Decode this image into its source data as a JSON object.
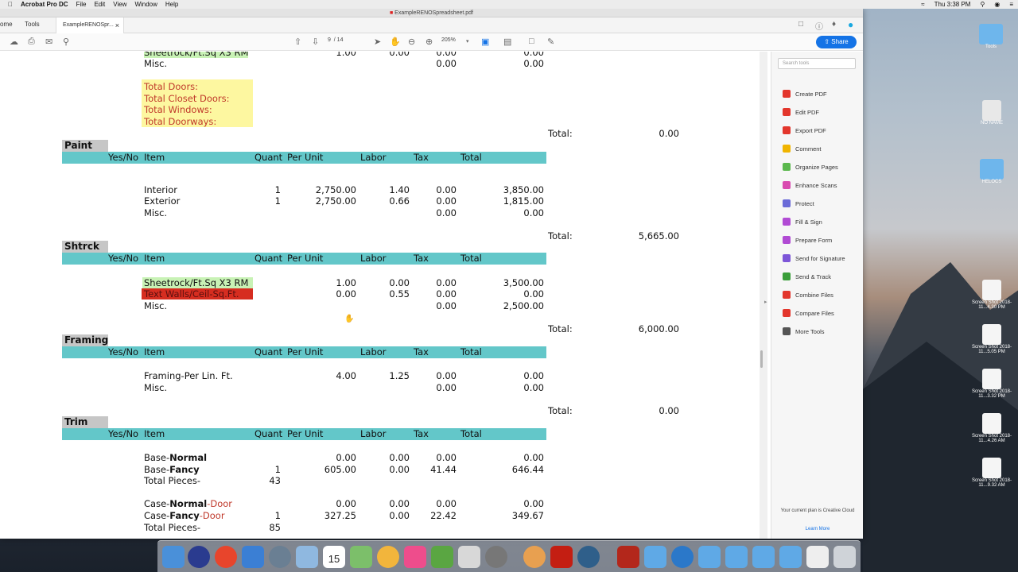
{
  "menubar": {
    "app": "Acrobat Pro DC",
    "items": [
      "File",
      "Edit",
      "View",
      "Window",
      "Help"
    ],
    "time": "Thu 3:38 PM"
  },
  "window": {
    "title": "ExampleRENOSpreadsheet.pdf"
  },
  "tabs": {
    "home": "ome",
    "tools": "Tools",
    "doc": "ExampleRENOSpr...",
    "close": "×"
  },
  "toolbar": {
    "page_current": "9",
    "page_total": "/ 14",
    "zoom": "205%",
    "share_label": "Share"
  },
  "right_panel": {
    "search_placeholder": "Search tools",
    "tools": [
      {
        "label": "Create PDF",
        "color": "#e3362c"
      },
      {
        "label": "Edit PDF",
        "color": "#e3362c"
      },
      {
        "label": "Export PDF",
        "color": "#e3362c"
      },
      {
        "label": "Comment",
        "color": "#f0b400"
      },
      {
        "label": "Organize Pages",
        "color": "#5bb84d"
      },
      {
        "label": "Enhance Scans",
        "color": "#d94bb0"
      },
      {
        "label": "Protect",
        "color": "#6b6bd8"
      },
      {
        "label": "Fill & Sign",
        "color": "#b14bd4"
      },
      {
        "label": "Prepare Form",
        "color": "#b14bd4"
      },
      {
        "label": "Send for Signature",
        "color": "#7d56d8"
      },
      {
        "label": "Send & Track",
        "color": "#3a9e3a"
      },
      {
        "label": "Combine Files",
        "color": "#e3362c"
      },
      {
        "label": "Compare Files",
        "color": "#e3362c"
      },
      {
        "label": "More Tools",
        "color": "#555555"
      }
    ],
    "plan_text": "Your current plan is Creative Cloud",
    "learn_more": "Learn More"
  },
  "col_headers": {
    "yesno": "Yes/No",
    "item": "Item",
    "quant": "Quant",
    "perunit": "Per Unit",
    "labor": "Labor",
    "tax": "Tax",
    "total": "Total"
  },
  "top": {
    "r1": {
      "item": "Sheetrock/Ft.Sq X3 RM",
      "per": "1.00",
      "labor": "0.00",
      "tax": "0.00",
      "total": "0.00"
    },
    "r2": {
      "item": "Misc.",
      "tax": "0.00",
      "total": "0.00"
    },
    "door_totals": [
      "Total Doors:",
      "Total Closet Doors:",
      "Total Windows:",
      "Total Doorways:"
    ],
    "total_label": "Total:",
    "total_value": "0.00"
  },
  "paint": {
    "title": "Paint",
    "r1": {
      "item": "Interior",
      "q": "1",
      "per": "2,750.00",
      "labor": "1.40",
      "tax": "0.00",
      "total": "3,850.00"
    },
    "r2": {
      "item": "Exterior",
      "q": "1",
      "per": "2,750.00",
      "labor": "0.66",
      "tax": "0.00",
      "total": "1,815.00"
    },
    "r3": {
      "item": "Misc.",
      "tax": "0.00",
      "total": "0.00"
    },
    "total_label": "Total:",
    "total_value": "5,665.00"
  },
  "shtrck": {
    "title": "Shtrck",
    "r1": {
      "item": "Sheetrock/Ft.Sq X3 RM",
      "per": "1.00",
      "labor": "0.00",
      "tax": "0.00",
      "total": "3,500.00"
    },
    "r2": {
      "item": "Text Walls/Ceil-Sq.Ft.",
      "per": "0.00",
      "labor": "0.55",
      "tax": "0.00",
      "total": "0.00"
    },
    "r3": {
      "item": "Misc.",
      "tax": "0.00",
      "total": "2,500.00"
    },
    "total_label": "Total:",
    "total_value": "6,000.00"
  },
  "framing": {
    "title": "Framing",
    "r1": {
      "item": "Framing-Per Lin. Ft.",
      "per": "4.00",
      "labor": "1.25",
      "tax": "0.00",
      "total": "0.00"
    },
    "r2": {
      "item": "Misc.",
      "tax": "0.00",
      "total": "0.00"
    },
    "total_label": "Total:",
    "total_value": "0.00"
  },
  "trim": {
    "title": "Trim",
    "r1": {
      "a": "Base-",
      "b": "Normal",
      "per": "0.00",
      "labor": "0.00",
      "tax": "0.00",
      "total": "0.00"
    },
    "r2": {
      "a": "Base-",
      "b": "Fancy",
      "q": "1",
      "per": "605.00",
      "labor": "0.00",
      "tax": "41.44",
      "total": "646.44"
    },
    "r3": {
      "item": "Total Pieces-",
      "q": "43"
    },
    "r4": {
      "a": "Case-",
      "b": "Normal",
      "c": "-Door",
      "per": "0.00",
      "labor": "0.00",
      "tax": "0.00",
      "total": "0.00"
    },
    "r5": {
      "a": "Case-",
      "b": "Fancy",
      "c": "-Door",
      "q": "1",
      "per": "327.25",
      "labor": "0.00",
      "tax": "22.42",
      "total": "349.67"
    },
    "r6": {
      "item": "Total Pieces-",
      "q": "85"
    }
  },
  "desktop": [
    {
      "label": "Tools"
    },
    {
      "label": "NO NAME"
    },
    {
      "label": "HELOCS"
    },
    {
      "label": "Screen Shot 2018-11...4.30 PM"
    },
    {
      "label": "Screen Shot 2018-11...5.05 PM"
    },
    {
      "label": "Screen Shot 2018-11...3.32 PM"
    },
    {
      "label": "Screen Shot 2018-11...4.26 AM"
    },
    {
      "label": "Screen Shot 2018-11...9.32 AM"
    }
  ],
  "dock": {
    "calendar_day": "15"
  }
}
